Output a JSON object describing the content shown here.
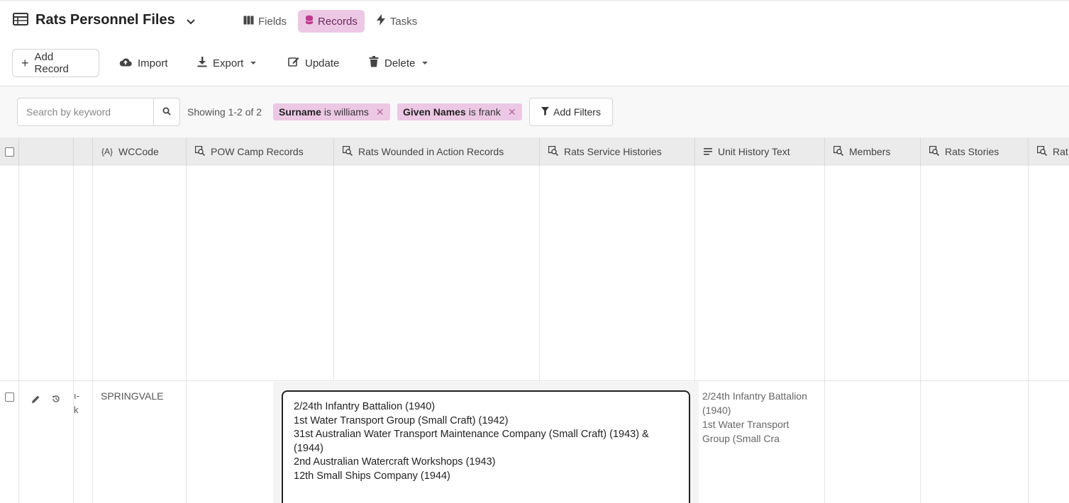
{
  "header": {
    "title": "Rats Personnel Files",
    "tabs": [
      {
        "label": "Fields",
        "icon": "columns-icon",
        "active": false
      },
      {
        "label": "Records",
        "icon": "database-icon",
        "active": true
      },
      {
        "label": "Tasks",
        "icon": "bolt-icon",
        "active": false
      }
    ]
  },
  "toolbar": {
    "add_record": "Add Record",
    "import": "Import",
    "export": "Export",
    "update": "Update",
    "delete": "Delete"
  },
  "filters": {
    "search_placeholder": "Search by keyword",
    "showing": "Showing 1-2 of 2",
    "chips": [
      {
        "field": "Surname",
        "op": "is williams"
      },
      {
        "field": "Given Names",
        "op": "is frank"
      }
    ],
    "add_filters": "Add Filters"
  },
  "columns": [
    {
      "label": "WCCode",
      "icon": "formula-icon"
    },
    {
      "label": "POW Camp Records",
      "icon": "linked-records-icon"
    },
    {
      "label": "Rats Wounded in Action Records",
      "icon": "linked-records-icon"
    },
    {
      "label": "Rats Service Histories",
      "icon": "linked-records-icon"
    },
    {
      "label": "Unit History Text",
      "icon": "paragraph-icon"
    },
    {
      "label": "Members",
      "icon": "linked-records-icon"
    },
    {
      "label": "Rats Stories",
      "icon": "linked-records-icon"
    },
    {
      "label": "Rat",
      "icon": "linked-records-icon"
    }
  ],
  "row2": {
    "truncated_name_1": "ı-",
    "truncated_name_2": "k",
    "wccode": "SPRINGVALE",
    "unit_history_preview": [
      "2/24th Infantry Battalion",
      "(1940)",
      "1st Water Transport",
      "Group (Small Cra"
    ],
    "unit_history_editor": [
      "2/24th Infantry Battalion (1940)",
      "1st Water Transport Group (Small Craft) (1942)",
      "31st Australian Water Transport Maintenance Company (Small Craft) (1943) &",
      "(1944)",
      "2nd Australian Watercraft Workshops (1943)",
      "12th Small Ships Company (1944)"
    ]
  },
  "colors": {
    "accent": "#ecc8e4",
    "accent_text": "#6a2a5f",
    "header_bg": "#ebebeb"
  }
}
